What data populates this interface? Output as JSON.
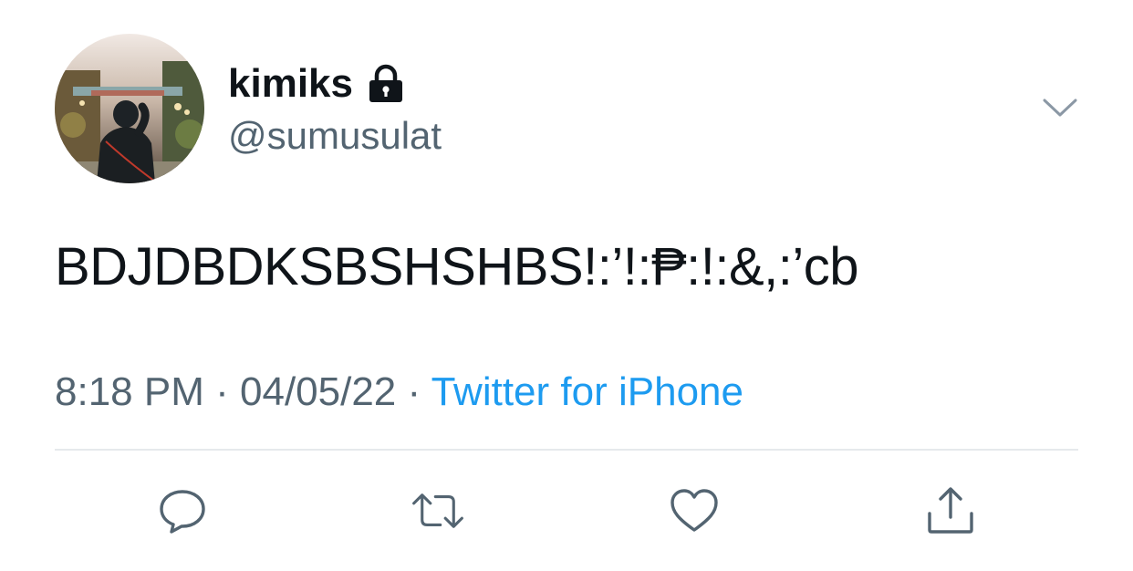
{
  "user": {
    "display_name": "kimiks",
    "handle": "@sumusulat",
    "protected_icon": "lock-icon",
    "avatar_icon": "avatar-photo"
  },
  "tweet": {
    "text": "BDJDBDKSBSHSHBS!:’!:₱:!:&,:’cb",
    "time": "8:18 PM",
    "date": "04/05/22",
    "separator": "·",
    "source": "Twitter for iPhone"
  },
  "actions": {
    "reply_icon": "reply-icon",
    "retweet_icon": "retweet-icon",
    "like_icon": "heart-icon",
    "share_icon": "share-icon",
    "more_icon": "chevron-down-icon"
  },
  "colors": {
    "text_primary": "#0f1419",
    "text_secondary": "#536471",
    "accent": "#1d9bf0",
    "icon": "#536471",
    "divider": "#e6e9ec"
  }
}
